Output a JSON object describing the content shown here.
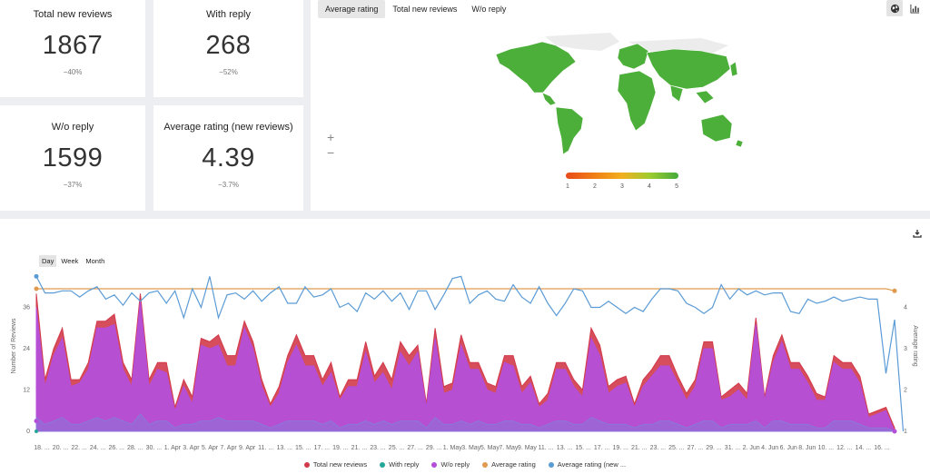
{
  "kpis": [
    {
      "label": "Total new reviews",
      "value": "1867",
      "change": "−40%"
    },
    {
      "label": "With reply",
      "value": "268",
      "change": "−52%"
    },
    {
      "label": "W/o reply",
      "value": "1599",
      "change": "−37%"
    },
    {
      "label": "Average rating (new reviews)",
      "value": "4.39",
      "change": "−3.7%"
    }
  ],
  "map": {
    "tabs": [
      "Average rating",
      "Total new reviews",
      "W/o reply"
    ],
    "active_tab": 0,
    "icons": [
      "globe-icon",
      "bar-chart-icon"
    ],
    "zoom_in": "+",
    "zoom_out": "−",
    "scale_labels": [
      "1",
      "2",
      "3",
      "4",
      "5"
    ],
    "scale_colors": [
      "#e84a1a",
      "#f07d15",
      "#f2b01e",
      "#9ccc2f",
      "#44aa3c"
    ],
    "land_color": "#4caf3a",
    "nodata_color": "#ececec"
  },
  "chart": {
    "periods": [
      "Day",
      "Week",
      "Month"
    ],
    "active_period": 0,
    "download_icon": "download-icon"
  },
  "chart_data": {
    "type": "area",
    "ylabel": "Number of Reviews",
    "y2label": "Average rating",
    "ylim": [
      0,
      48
    ],
    "y2lim": [
      1,
      5
    ],
    "yticks": [
      0,
      12,
      24,
      36
    ],
    "y2ticks": [
      1,
      2,
      3,
      4
    ],
    "x_ticks": [
      "18. ...",
      "20. ...",
      "22. ...",
      "24. ...",
      "26. ...",
      "28. ...",
      "30. ...",
      "1. Apr",
      "3. Apr",
      "5. Apr",
      "7. Apr",
      "9. Apr",
      "11. ...",
      "13. ...",
      "15. ...",
      "17. ...",
      "19. ...",
      "21. ...",
      "23. ...",
      "25. ...",
      "27. ...",
      "29. ...",
      "1. May",
      "3. May",
      "5. May",
      "7. May",
      "9. May",
      "11. ...",
      "13. ...",
      "15. ...",
      "17. ...",
      "19. ...",
      "21. ...",
      "23. ...",
      "25. ...",
      "27. ...",
      "29. ...",
      "31. ...",
      "2. Jun",
      "4. Jun",
      "6. Jun",
      "8. Jun",
      "10. ...",
      "12. ...",
      "14. ...",
      "16. ..."
    ],
    "series": [
      {
        "name": "Total new reviews",
        "color": "#d23a4a",
        "values": [
          40,
          15,
          24,
          30,
          15,
          15,
          20,
          32,
          32,
          34,
          20,
          15,
          40,
          15,
          20,
          20,
          7,
          15,
          10,
          27,
          26,
          28,
          22,
          22,
          32,
          26,
          15,
          8,
          13,
          22,
          28,
          22,
          22,
          15,
          20,
          10,
          15,
          15,
          26,
          16,
          20,
          15,
          26,
          22,
          25,
          8,
          30,
          13,
          14,
          28,
          20,
          20,
          14,
          13,
          22,
          22,
          13,
          16,
          8,
          11,
          20,
          20,
          15,
          12,
          30,
          25,
          13,
          15,
          16,
          8,
          15,
          18,
          22,
          22,
          16,
          11,
          15,
          26,
          26,
          10,
          12,
          14,
          11,
          33,
          10,
          22,
          28,
          20,
          20,
          16,
          11,
          10,
          22,
          20,
          20,
          16,
          5,
          6,
          7,
          1
        ]
      },
      {
        "name": "W/o reply",
        "color": "#b44fd8",
        "values": [
          36,
          13,
          22,
          27,
          13,
          14,
          18,
          30,
          30,
          31,
          18,
          13,
          38,
          13,
          18,
          17,
          6,
          13,
          8,
          25,
          24,
          25,
          19,
          19,
          30,
          24,
          13,
          7,
          11,
          20,
          25,
          19,
          19,
          13,
          17,
          9,
          13,
          13,
          23,
          14,
          17,
          12,
          23,
          19,
          23,
          7,
          27,
          11,
          12,
          25,
          18,
          18,
          12,
          11,
          20,
          19,
          11,
          14,
          7,
          9,
          18,
          18,
          13,
          10,
          27,
          22,
          11,
          13,
          14,
          7,
          13,
          16,
          19,
          19,
          14,
          9,
          13,
          24,
          24,
          9,
          10,
          12,
          9,
          31,
          9,
          20,
          26,
          18,
          18,
          14,
          9,
          9,
          20,
          18,
          18,
          14,
          4,
          5,
          6,
          0
        ]
      },
      {
        "name": "With reply",
        "color": "#8b77d9",
        "values": [
          4,
          2,
          3,
          4,
          2,
          2,
          3,
          4,
          3,
          4,
          3,
          2,
          5,
          2,
          3,
          3,
          1,
          2,
          2,
          3,
          3,
          4,
          3,
          3,
          3,
          3,
          2,
          1,
          2,
          3,
          3,
          3,
          3,
          2,
          3,
          1,
          2,
          2,
          3,
          2,
          3,
          2,
          3,
          3,
          3,
          1,
          4,
          2,
          2,
          3,
          2,
          3,
          2,
          2,
          3,
          3,
          2,
          2,
          1,
          2,
          3,
          3,
          2,
          2,
          4,
          3,
          2,
          2,
          2,
          1,
          2,
          2,
          3,
          3,
          2,
          1,
          2,
          3,
          3,
          1,
          2,
          2,
          2,
          3,
          1,
          3,
          3,
          2,
          2,
          2,
          1,
          1,
          3,
          3,
          3,
          2,
          1,
          1,
          1,
          0
        ]
      },
      {
        "name": "Average rating",
        "axis": "right",
        "color": "#e09a4f",
        "values": [
          4.45,
          4.45,
          4.45,
          4.45,
          4.45,
          4.45,
          4.45,
          4.45,
          4.45,
          4.45,
          4.45,
          4.45,
          4.45,
          4.45,
          4.45,
          4.45,
          4.45,
          4.45,
          4.45,
          4.45,
          4.45,
          4.45,
          4.45,
          4.45,
          4.45,
          4.45,
          4.45,
          4.45,
          4.45,
          4.45,
          4.45,
          4.45,
          4.45,
          4.45,
          4.45,
          4.45,
          4.45,
          4.45,
          4.45,
          4.45,
          4.45,
          4.45,
          4.45,
          4.45,
          4.45,
          4.45,
          4.45,
          4.45,
          4.45,
          4.45,
          4.45,
          4.45,
          4.45,
          4.45,
          4.45,
          4.45,
          4.45,
          4.45,
          4.45,
          4.45,
          4.45,
          4.45,
          4.45,
          4.45,
          4.45,
          4.45,
          4.45,
          4.45,
          4.45,
          4.45,
          4.45,
          4.45,
          4.45,
          4.45,
          4.45,
          4.45,
          4.45,
          4.45,
          4.45,
          4.45,
          4.45,
          4.45,
          4.45,
          4.45,
          4.45,
          4.45,
          4.45,
          4.45,
          4.45,
          4.45,
          4.45,
          4.45,
          4.45,
          4.45,
          4.45,
          4.45,
          4.45,
          4.45,
          4.45,
          4.4
        ]
      },
      {
        "name": "Average rating (new ...",
        "axis": "right",
        "color": "#5b9bd5",
        "values": [
          4.75,
          4.35,
          4.35,
          4.4,
          4.4,
          4.25,
          4.4,
          4.5,
          4.2,
          4.3,
          4.05,
          4.35,
          4.15,
          4.35,
          4.4,
          4.1,
          4.4,
          3.75,
          4.45,
          4.0,
          4.75,
          3.75,
          4.3,
          4.35,
          4.2,
          4.4,
          4.15,
          4.35,
          4.5,
          4.1,
          4.1,
          4.5,
          4.25,
          4.3,
          4.45,
          4.0,
          4.1,
          3.9,
          4.35,
          4.2,
          4.4,
          4.15,
          4.35,
          3.95,
          4.4,
          4.4,
          3.95,
          4.3,
          4.7,
          4.75,
          4.1,
          4.3,
          4.4,
          4.2,
          4.15,
          4.55,
          4.25,
          4.1,
          4.5,
          4.1,
          3.8,
          4.1,
          4.45,
          4.4,
          4.0,
          4.0,
          4.15,
          4.0,
          3.85,
          4.0,
          3.9,
          4.2,
          4.45,
          4.45,
          4.4,
          4.1,
          4.0,
          3.85,
          4.0,
          4.55,
          4.2,
          4.45,
          4.3,
          4.4,
          4.3,
          4.35,
          4.35,
          3.9,
          3.85,
          4.2,
          4.1,
          4.15,
          4.25,
          4.15,
          4.2,
          4.25,
          4.2,
          4.2,
          2.4,
          3.7,
          1.0
        ]
      }
    ]
  }
}
